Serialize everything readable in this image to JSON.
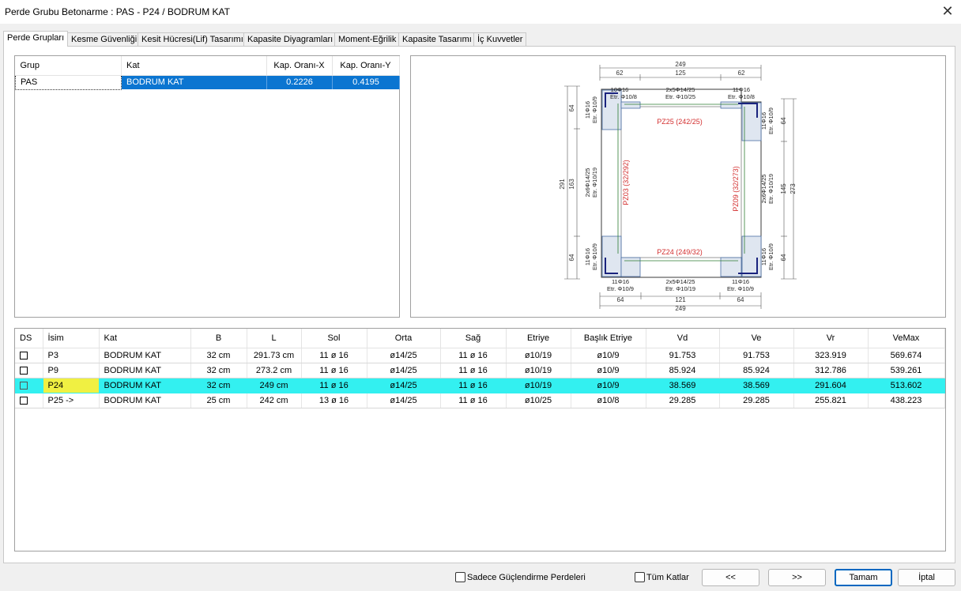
{
  "window": {
    "title": "Perde Grubu Betonarme  :  PAS - P24 / BODRUM KAT",
    "close_glyph": "✕"
  },
  "tabs": [
    "Perde Grupları",
    "Kesme Güvenliği",
    "Kesit Hücresi(Lif) Tasarımı",
    "Kapasite Diyagramları",
    "Moment-Eğrilik",
    "Kapasite Tasarımı",
    "İç Kuvvetler"
  ],
  "group_table": {
    "headers": [
      "Grup",
      "Kat",
      "Kap. Oranı-X",
      "Kap. Oranı-Y"
    ],
    "rows": [
      {
        "grup": "PAS",
        "kat": "BODRUM KAT",
        "kx": "0.2226",
        "ky": "0.4195"
      }
    ]
  },
  "drawing": {
    "top_total": "249",
    "top_left": "62",
    "top_mid": "125",
    "top_right": "62",
    "bot_left": "64",
    "bot_mid": "121",
    "bot_right": "64",
    "bot_total": "249",
    "left_top": "64",
    "left_total": "291",
    "left_mid": "163",
    "left_bot": "64",
    "right_top": "64",
    "right_mid": "145",
    "right_total": "273",
    "right_bot": "64",
    "top_lbl_left_a": "10Φ16",
    "top_lbl_left_b": "Etr. Φ10/8",
    "top_lbl_mid_a": "2x5Φ14/25",
    "top_lbl_mid_b": "Etr. Φ10/25",
    "top_lbl_right_a": "11Φ16",
    "top_lbl_right_b": "Etr. Φ10/8",
    "bot_lbl_left_a": "11Φ16",
    "bot_lbl_left_b": "Etr. Φ10/9",
    "bot_lbl_mid_a": "2x5Φ14/25",
    "bot_lbl_mid_b": "Etr. Φ10/19",
    "bot_lbl_right_a": "11Φ16",
    "bot_lbl_right_b": "Etr. Φ10/9",
    "left_lbl_top_a": "11Φ16",
    "left_lbl_top_b": "Etr. Φ10/9",
    "left_lbl_mid_a": "2x6Φ14/25",
    "left_lbl_mid_b": "Etr. Φ10/19",
    "left_lbl_bot_a": "11Φ16",
    "left_lbl_bot_b": "Etr. Φ10/9",
    "right_lbl_top_a": "11Φ16",
    "right_lbl_top_b": "Etr. Φ10/9",
    "right_lbl_mid_a": "2x6Φ14/25",
    "right_lbl_mid_b": "Etr. Φ10/19",
    "right_lbl_bot_a": "11Φ16",
    "right_lbl_bot_b": "Etr. Φ10/9",
    "pz25": "PZ25 (242/25)",
    "pz24": "PZ24 (249/32)",
    "pz03": "PZ03 (32/292)",
    "pz09": "PZ09 (32/273)"
  },
  "wall_table": {
    "headers": [
      "DS",
      "İsim",
      "Kat",
      "B",
      "L",
      "Sol",
      "Orta",
      "Sağ",
      "Etriye",
      "Başlık Etriye",
      "Vd",
      "Ve",
      "Vr",
      "VeMax"
    ],
    "rows": [
      {
        "isim": "P3",
        "kat": "BODRUM KAT",
        "b": "32 cm",
        "l": "291.73 cm",
        "sol": "11 ø 16",
        "orta": "ø14/25",
        "sag": "11 ø 16",
        "etriye": "ø10/19",
        "baslik": "ø10/9",
        "vd": "91.753",
        "ve": "91.753",
        "vr": "323.919",
        "vemax": "569.674"
      },
      {
        "isim": "P9",
        "kat": "BODRUM KAT",
        "b": "32 cm",
        "l": "273.2 cm",
        "sol": "11 ø 16",
        "orta": "ø14/25",
        "sag": "11 ø 16",
        "etriye": "ø10/19",
        "baslik": "ø10/9",
        "vd": "85.924",
        "ve": "85.924",
        "vr": "312.786",
        "vemax": "539.261"
      },
      {
        "isim": "P24",
        "kat": "BODRUM KAT",
        "b": "32 cm",
        "l": "249 cm",
        "sol": "11 ø 16",
        "orta": "ø14/25",
        "sag": "11 ø 16",
        "etriye": "ø10/19",
        "baslik": "ø10/9",
        "vd": "38.569",
        "ve": "38.569",
        "vr": "291.604",
        "vemax": "513.602"
      },
      {
        "isim": "P25 ->",
        "kat": "BODRUM KAT",
        "b": "25 cm",
        "l": "242 cm",
        "sol": "13 ø 16",
        "orta": "ø14/25",
        "sag": "11 ø 16",
        "etriye": "ø10/25",
        "baslik": "ø10/8",
        "vd": "29.285",
        "ve": "29.285",
        "vr": "255.821",
        "vemax": "438.223"
      }
    ]
  },
  "bottom": {
    "chk_guclendirme": "Sadece Güçlendirme Perdeleri",
    "chk_tum": "Tüm Katlar",
    "prev": "<<",
    "next": ">>",
    "ok": "Tamam",
    "cancel": "İptal"
  }
}
